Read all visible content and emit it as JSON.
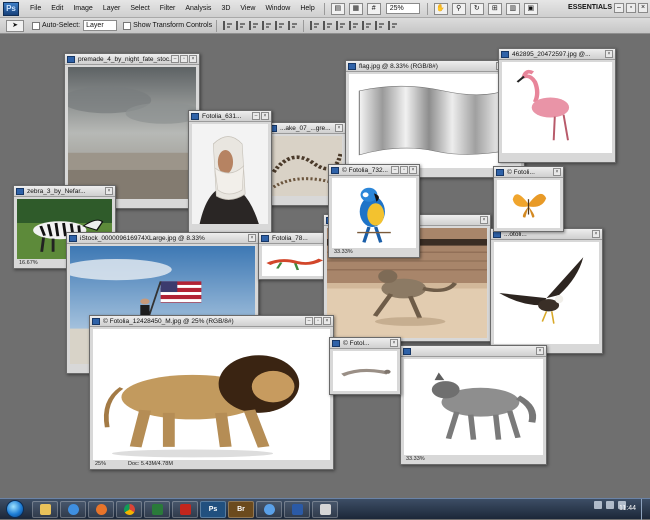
{
  "menubar": {
    "logo": "Ps",
    "items": [
      "File",
      "Edit",
      "Image",
      "Layer",
      "Select",
      "Filter",
      "Analysis",
      "3D",
      "View",
      "Window",
      "Help"
    ],
    "zoom": "25%",
    "workspace": "ESSENTIALS",
    "icons": [
      "bridge-icon",
      "mini-bridge-icon",
      "hand-icon",
      "zoom-icon",
      "rotate-icon",
      "arrange-icon",
      "screen-mode-icon"
    ]
  },
  "options": {
    "auto_select_label": "Auto-Select:",
    "auto_select_value": "Layer",
    "transform_label": "Show Transform Controls"
  },
  "documents": [
    {
      "title": "premade_4_by_night_fate_stoc...",
      "icon": "document-icon"
    },
    {
      "title": "Fotolia_631...",
      "icon": "document-icon"
    },
    {
      "title": "...ake_07_...gre...",
      "icon": "document-icon"
    },
    {
      "title": "flag.jpg @ 8.33% (RGB/8#)",
      "icon": "document-icon"
    },
    {
      "title": "462895_20472597.jpg @...",
      "icon": "document-icon"
    },
    {
      "title": "zebra_3_by_Nefar...",
      "zoom": "16.67%",
      "icon": "document-icon"
    },
    {
      "title": "iStock_000009616974XLarge.jpg @ 8.33%",
      "zoom": "8.33%",
      "icon": "document-icon"
    },
    {
      "title": "Fotolia_78...",
      "icon": "document-icon"
    },
    {
      "title": "© Fotolia_732...",
      "zoom": "33.33%",
      "icon": "document-icon"
    },
    {
      "title": "© Fotoli...",
      "icon": "document-icon"
    },
    {
      "title": "...tock_0... @ 12...",
      "icon": "document-icon"
    },
    {
      "title": "...otoli...",
      "icon": "document-icon"
    },
    {
      "title": "© Fotolia_12428450_M.jpg @ 25% (RGB/8#)",
      "zoom": "25%",
      "doc_info": "Doc: 5.43M/4.78M",
      "icon": "document-icon"
    },
    {
      "title": "© Fotol...",
      "icon": "document-icon"
    },
    {
      "title": "",
      "zoom": "33.33%",
      "icon": "document-icon"
    }
  ],
  "window_buttons": {
    "minimize": "–",
    "maximize": "▫",
    "close": "×"
  },
  "taskbar": {
    "apps": [
      "explorer",
      "ie",
      "firefox",
      "chrome",
      "media",
      "acrobat",
      "photoshop",
      "bridge",
      "ie2",
      "word",
      "mail"
    ],
    "ps_label": "Ps",
    "br_label": "Br",
    "time": "11:44"
  },
  "colors": {
    "workspace_bg": "#6f6f6f",
    "ps_blue": "#2f62a8",
    "taskbar": "#1c2739"
  }
}
